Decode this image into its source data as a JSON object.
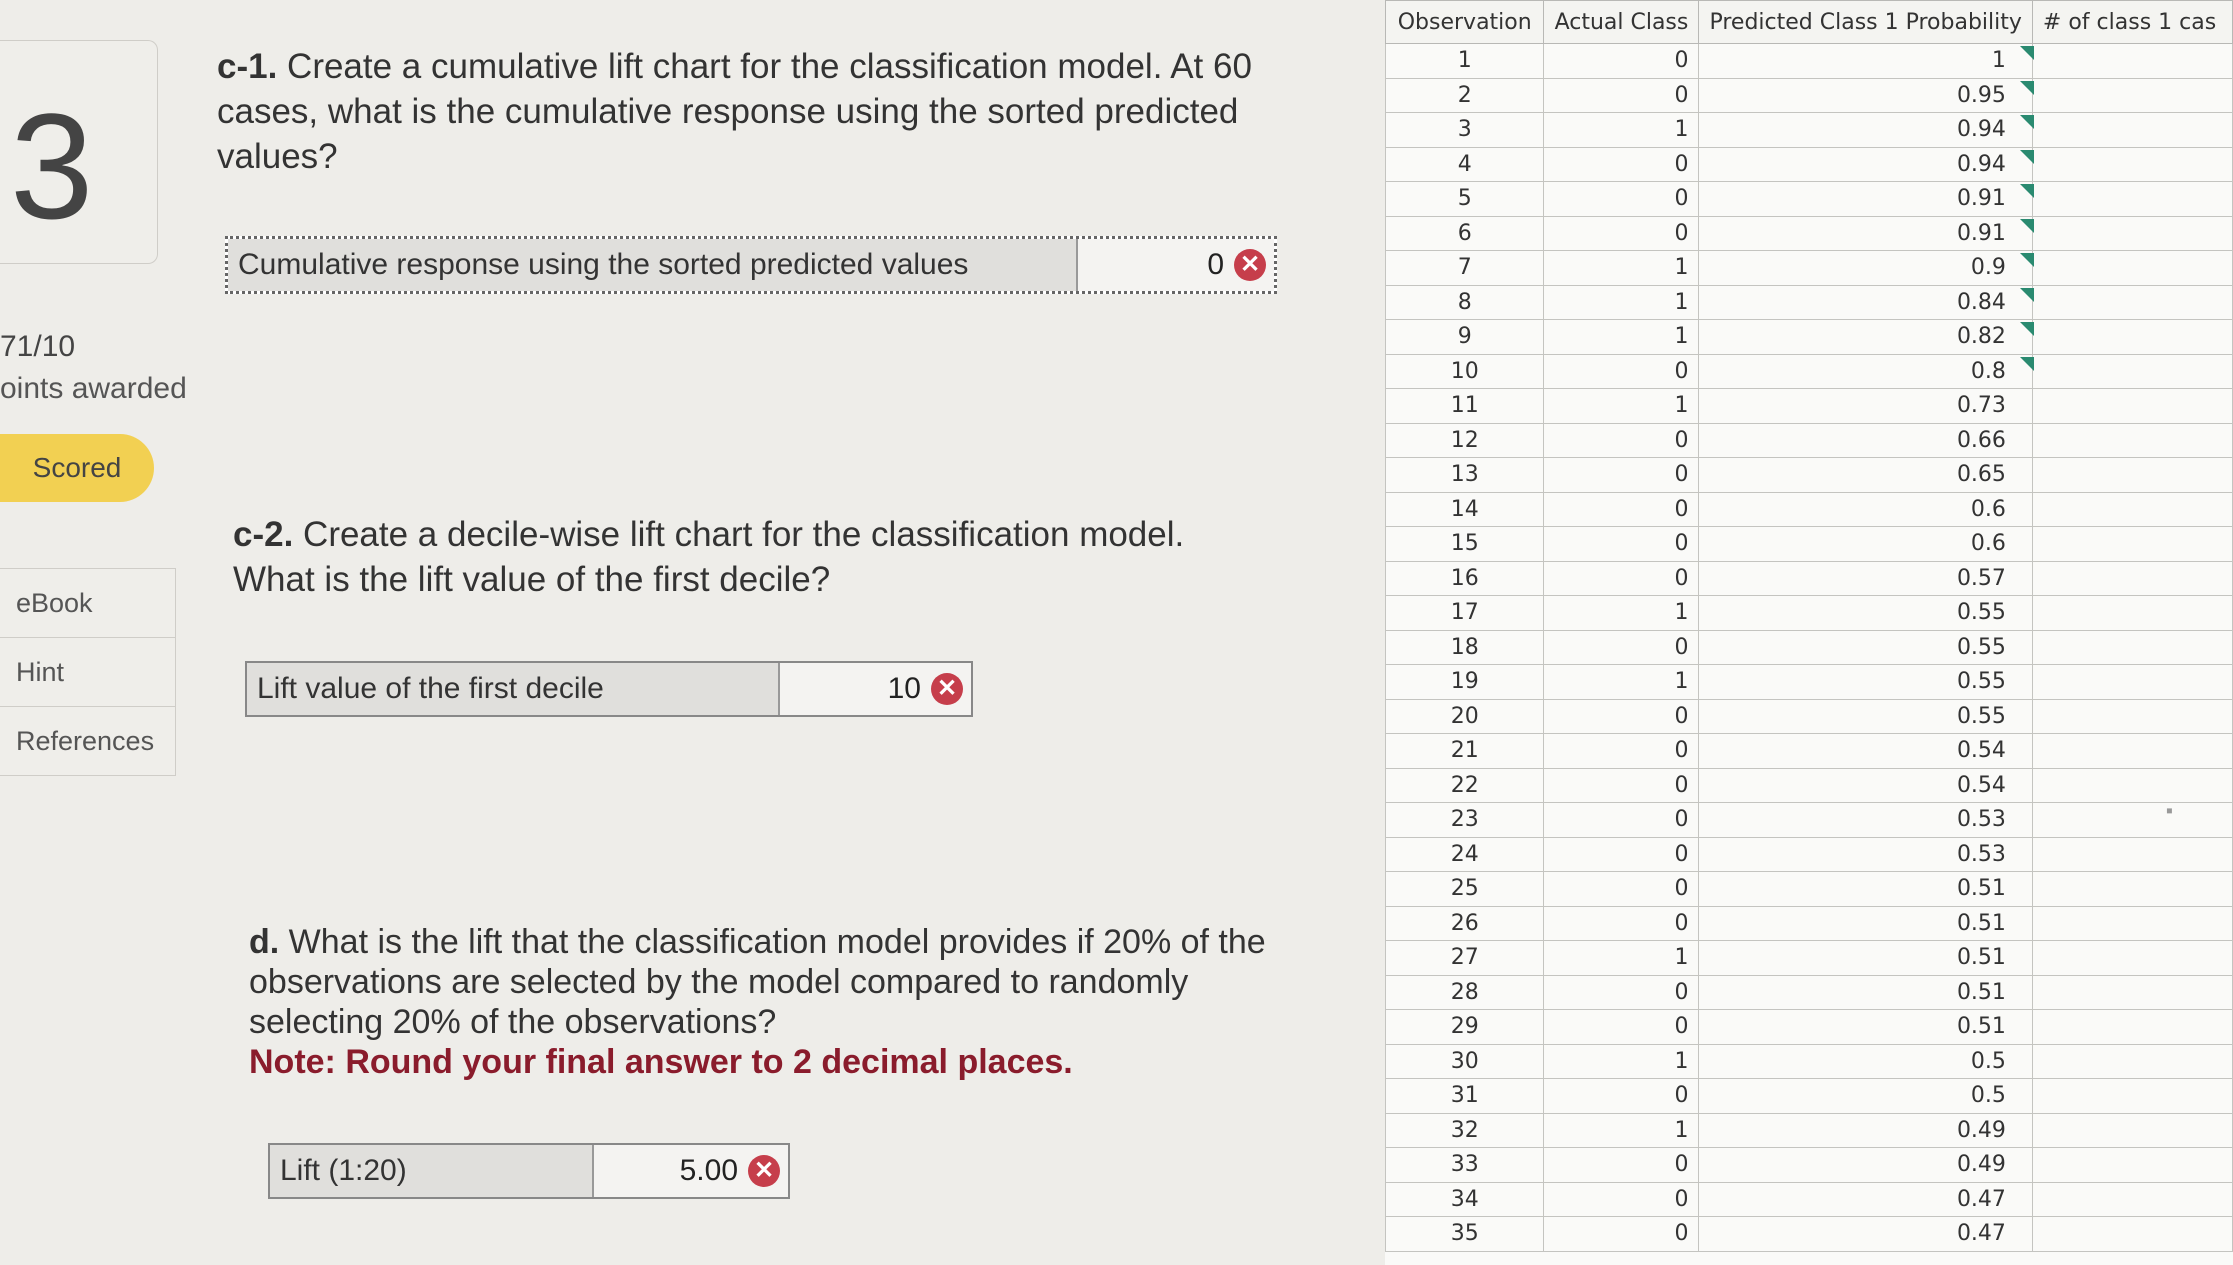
{
  "sidebar": {
    "question_number": "3",
    "points": "71/10",
    "points_label": "oints awarded",
    "status": "Scored",
    "nav": [
      "eBook",
      "Hint",
      "References"
    ]
  },
  "questions": {
    "c1": {
      "number": "c-1.",
      "text": " Create a cumulative lift chart for the classification model. At 60 cases, what is the cumulative response using the sorted predicted values?",
      "answer_label": "Cumulative response using the sorted predicted values",
      "answer_value": "0"
    },
    "c2": {
      "number": "c-2.",
      "text": " Create a decile-wise lift chart for the classification model. What is the lift value of the first decile?",
      "answer_label": "Lift value of the first decile",
      "answer_value": "10"
    },
    "d": {
      "number": "d.",
      "text": " What is the lift that the classification model provides if 20% of the observations are selected by the model compared to randomly selecting 20% of the observations?",
      "note": "Note: Round your final answer to 2 decimal places.",
      "answer_label": "Lift (1:20)",
      "answer_value": "5.00"
    }
  },
  "table": {
    "headers": [
      "Observation",
      "Actual Class",
      "Predicted Class 1 Probability",
      "# of class 1 cas"
    ],
    "rows": [
      [
        "1",
        "0",
        "1"
      ],
      [
        "2",
        "0",
        "0.95"
      ],
      [
        "3",
        "1",
        "0.94"
      ],
      [
        "4",
        "0",
        "0.94"
      ],
      [
        "5",
        "0",
        "0.91"
      ],
      [
        "6",
        "0",
        "0.91"
      ],
      [
        "7",
        "1",
        "0.9"
      ],
      [
        "8",
        "1",
        "0.84"
      ],
      [
        "9",
        "1",
        "0.82"
      ],
      [
        "10",
        "0",
        "0.8"
      ],
      [
        "11",
        "1",
        "0.73"
      ],
      [
        "12",
        "0",
        "0.66"
      ],
      [
        "13",
        "0",
        "0.65"
      ],
      [
        "14",
        "0",
        "0.6"
      ],
      [
        "15",
        "0",
        "0.6"
      ],
      [
        "16",
        "0",
        "0.57"
      ],
      [
        "17",
        "1",
        "0.55"
      ],
      [
        "18",
        "0",
        "0.55"
      ],
      [
        "19",
        "1",
        "0.55"
      ],
      [
        "20",
        "0",
        "0.55"
      ],
      [
        "21",
        "0",
        "0.54"
      ],
      [
        "22",
        "0",
        "0.54"
      ],
      [
        "23",
        "0",
        "0.53"
      ],
      [
        "24",
        "0",
        "0.53"
      ],
      [
        "25",
        "0",
        "0.51"
      ],
      [
        "26",
        "0",
        "0.51"
      ],
      [
        "27",
        "1",
        "0.51"
      ],
      [
        "28",
        "0",
        "0.51"
      ],
      [
        "29",
        "0",
        "0.51"
      ],
      [
        "30",
        "1",
        "0.5"
      ],
      [
        "31",
        "0",
        "0.5"
      ],
      [
        "32",
        "1",
        "0.49"
      ],
      [
        "33",
        "0",
        "0.49"
      ],
      [
        "34",
        "0",
        "0.47"
      ],
      [
        "35",
        "0",
        "0.47"
      ]
    ],
    "flagged_rows": 10
  }
}
